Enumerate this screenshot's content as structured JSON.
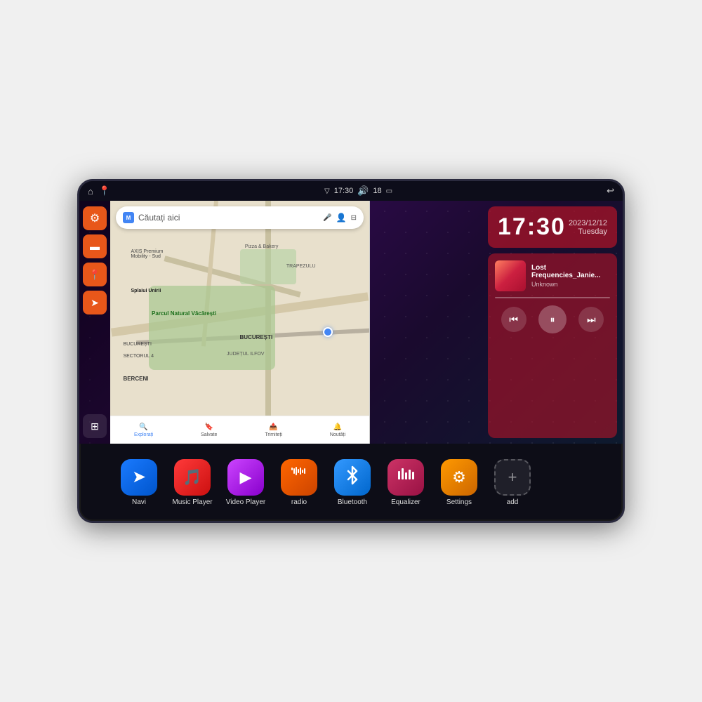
{
  "device": {
    "status_bar": {
      "left_icons": [
        "⌂",
        "📍"
      ],
      "time": "17:30",
      "wifi": "▽",
      "volume": "🔊",
      "battery": "18",
      "battery_icon": "🔋",
      "back": "↩"
    },
    "clock": {
      "time": "17:30",
      "date": "2023/12/12",
      "day": "Tuesday"
    },
    "music": {
      "track": "Lost Frequencies_Janie...",
      "artist": "Unknown",
      "controls": {
        "prev": "⏮",
        "play": "⏸",
        "next": "⏭"
      }
    },
    "map": {
      "search_placeholder": "Căutați aici",
      "labels": [
        "AXIS Premium Mobility - Sud",
        "Pizza & Bakery",
        "TRAPEZULU",
        "Parcul Natural Văcărești",
        "BUCUREȘTI",
        "JUDEȚUL ILFOV",
        "BUCUREȘTI SECTORUL 4",
        "BERCENI",
        "Splaiui Unirii"
      ],
      "bottom_items": [
        "Explorați",
        "Salvate",
        "Trimiteți",
        "Noutăți"
      ]
    },
    "apps": [
      {
        "id": "navi",
        "label": "Navi",
        "icon": "nav",
        "color": "navi-bg"
      },
      {
        "id": "music-player",
        "label": "Music Player",
        "icon": "music",
        "color": "music-bg"
      },
      {
        "id": "video-player",
        "label": "Video Player",
        "icon": "video",
        "color": "video-bg"
      },
      {
        "id": "radio",
        "label": "radio",
        "icon": "radio",
        "color": "radio-bg"
      },
      {
        "id": "bluetooth",
        "label": "Bluetooth",
        "icon": "bt",
        "color": "bt-bg"
      },
      {
        "id": "equalizer",
        "label": "Equalizer",
        "icon": "eq",
        "color": "eq-bg"
      },
      {
        "id": "settings",
        "label": "Settings",
        "icon": "gear",
        "color": "settings-bg"
      },
      {
        "id": "add",
        "label": "add",
        "icon": "plus",
        "color": "add-bg"
      }
    ],
    "sidebar": [
      {
        "id": "settings-side",
        "icon": "⚙",
        "type": "orange"
      },
      {
        "id": "files-side",
        "icon": "📁",
        "type": "orange"
      },
      {
        "id": "maps-side",
        "icon": "📍",
        "type": "orange"
      },
      {
        "id": "nav-side",
        "icon": "➤",
        "type": "orange"
      },
      {
        "id": "apps-side",
        "icon": "⊞",
        "type": "dark"
      }
    ]
  }
}
